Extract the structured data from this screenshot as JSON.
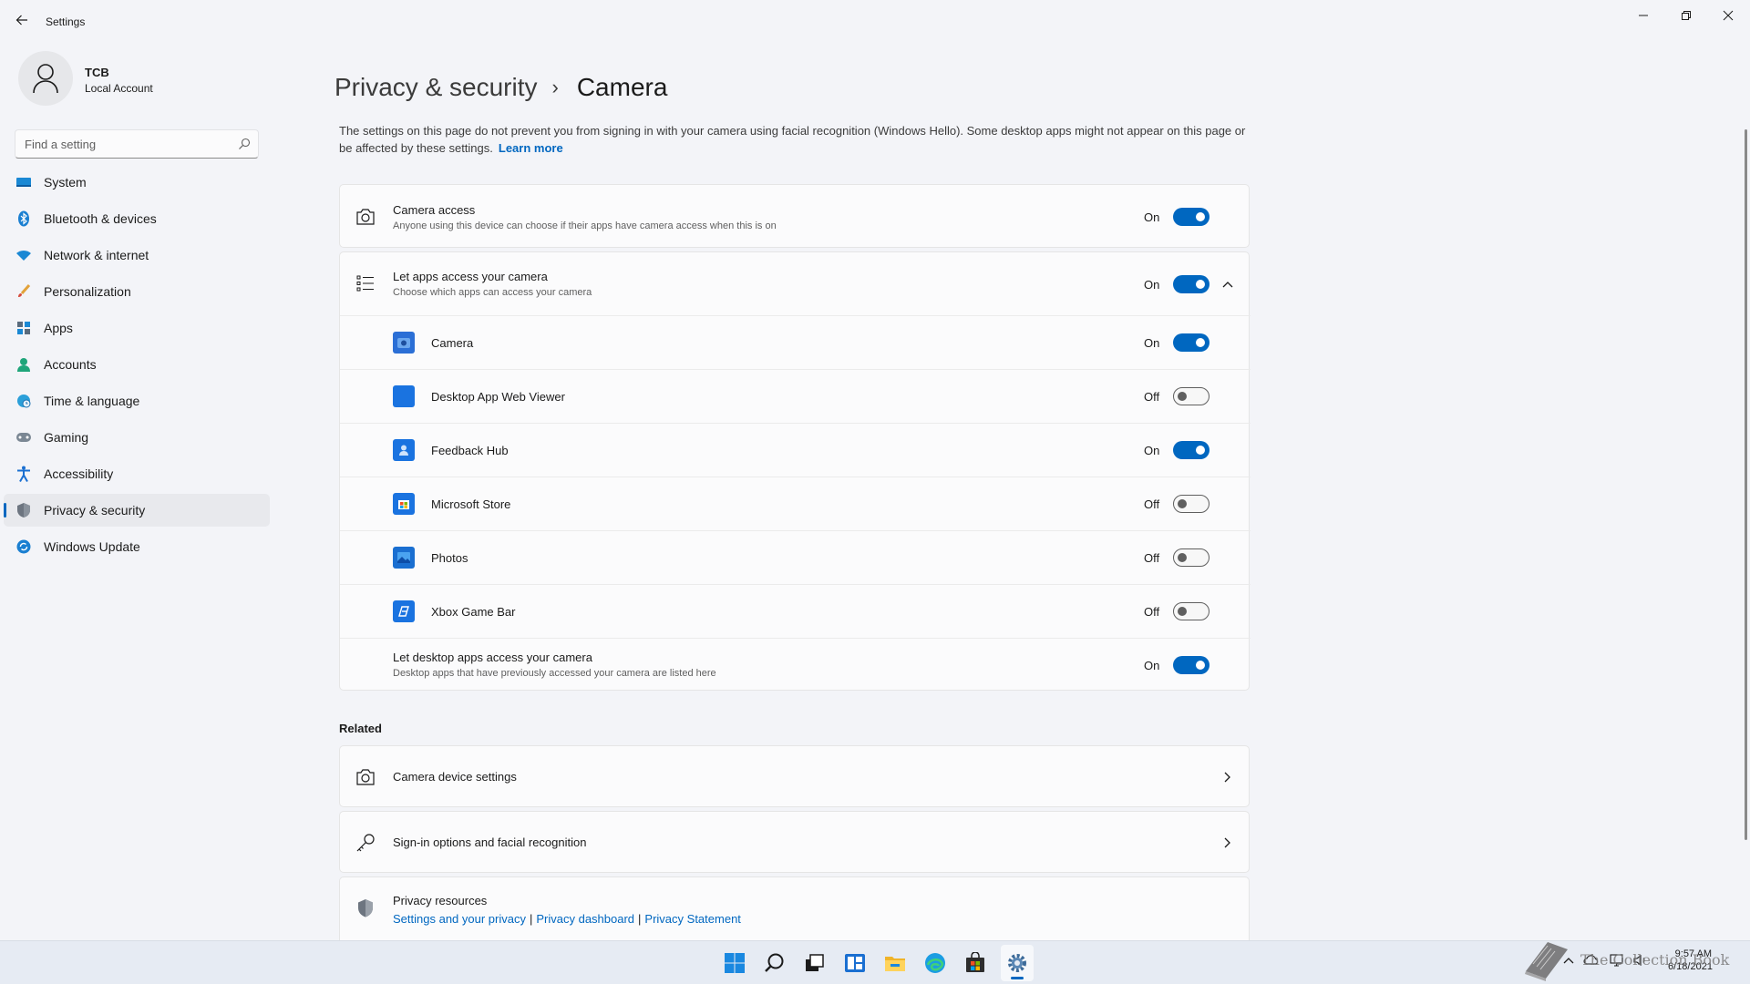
{
  "window": {
    "title": "Settings",
    "back_icon": "back-arrow-icon",
    "controls": [
      "minimize-icon",
      "restore-icon",
      "close-icon"
    ]
  },
  "profile": {
    "name": "TCB",
    "account_type": "Local Account",
    "avatar_icon": "person-icon"
  },
  "search": {
    "placeholder": "Find a setting",
    "value": ""
  },
  "sidebar": {
    "items": [
      {
        "label": "System",
        "icon": "monitor-icon",
        "active": false
      },
      {
        "label": "Bluetooth & devices",
        "icon": "bluetooth-icon",
        "active": false
      },
      {
        "label": "Network & internet",
        "icon": "wifi-icon",
        "active": false
      },
      {
        "label": "Personalization",
        "icon": "brush-icon",
        "active": false
      },
      {
        "label": "Apps",
        "icon": "apps-icon",
        "active": false
      },
      {
        "label": "Accounts",
        "icon": "person-icon",
        "active": false
      },
      {
        "label": "Time & language",
        "icon": "globe-clock-icon",
        "active": false
      },
      {
        "label": "Gaming",
        "icon": "gamepad-icon",
        "active": false
      },
      {
        "label": "Accessibility",
        "icon": "accessibility-icon",
        "active": false
      },
      {
        "label": "Privacy & security",
        "icon": "shield-icon",
        "active": true
      },
      {
        "label": "Windows Update",
        "icon": "update-icon",
        "active": false
      }
    ]
  },
  "breadcrumb": {
    "parent": "Privacy & security",
    "separator": "›",
    "current": "Camera"
  },
  "intro": {
    "text": "The settings on this page do not prevent you from signing in with your camera using facial recognition (Windows Hello). Some desktop apps might not appear on this page or be affected by these settings.",
    "link": "Learn more"
  },
  "camera_access": {
    "title": "Camera access",
    "subtitle": "Anyone using this device can choose if their apps have camera access when this is on",
    "state": "On",
    "icon": "camera-icon"
  },
  "let_apps": {
    "title": "Let apps access your camera",
    "subtitle": "Choose which apps can access your camera",
    "state": "On",
    "icon": "list-icon",
    "expand_icon": "chevron-up-icon"
  },
  "apps": [
    {
      "name": "Camera",
      "state": "On",
      "icon": "camera-app-icon"
    },
    {
      "name": "Desktop App Web Viewer",
      "state": "Off",
      "icon": "web-viewer-app-icon"
    },
    {
      "name": "Feedback Hub",
      "state": "On",
      "icon": "feedback-hub-app-icon"
    },
    {
      "name": "Microsoft Store",
      "state": "Off",
      "icon": "store-app-icon"
    },
    {
      "name": "Photos",
      "state": "Off",
      "icon": "photos-app-icon"
    },
    {
      "name": "Xbox Game Bar",
      "state": "Off",
      "icon": "xbox-game-bar-app-icon"
    }
  ],
  "desktop_apps": {
    "title": "Let desktop apps access your camera",
    "subtitle": "Desktop apps that have previously accessed your camera are listed here",
    "state": "On"
  },
  "related": {
    "heading": "Related",
    "items": [
      {
        "label": "Camera device settings",
        "icon": "camera-icon"
      },
      {
        "label": "Sign-in options and facial recognition",
        "icon": "key-icon"
      }
    ],
    "resources": {
      "title": "Privacy resources",
      "icon": "shield-icon",
      "links": [
        "Settings and your privacy",
        "Privacy dashboard",
        "Privacy Statement"
      ],
      "separator": "|"
    }
  },
  "taskbar": {
    "icons": [
      "start-icon",
      "search-icon",
      "task-view-icon",
      "widgets-icon",
      "file-explorer-icon",
      "edge-icon",
      "store-icon",
      "settings-icon"
    ],
    "active": "settings-icon",
    "tray_icons": [
      "chevron-up-icon",
      "cloud-icon",
      "network-icon",
      "volume-icon"
    ],
    "time": "9:57 AM",
    "date": "6/18/2021"
  },
  "watermark": {
    "text": "The Collection Book",
    "icon": "book-icon"
  },
  "colors": {
    "accent": "#0067c0",
    "background": "#f3f4f8",
    "card": "#fbfbfc"
  }
}
